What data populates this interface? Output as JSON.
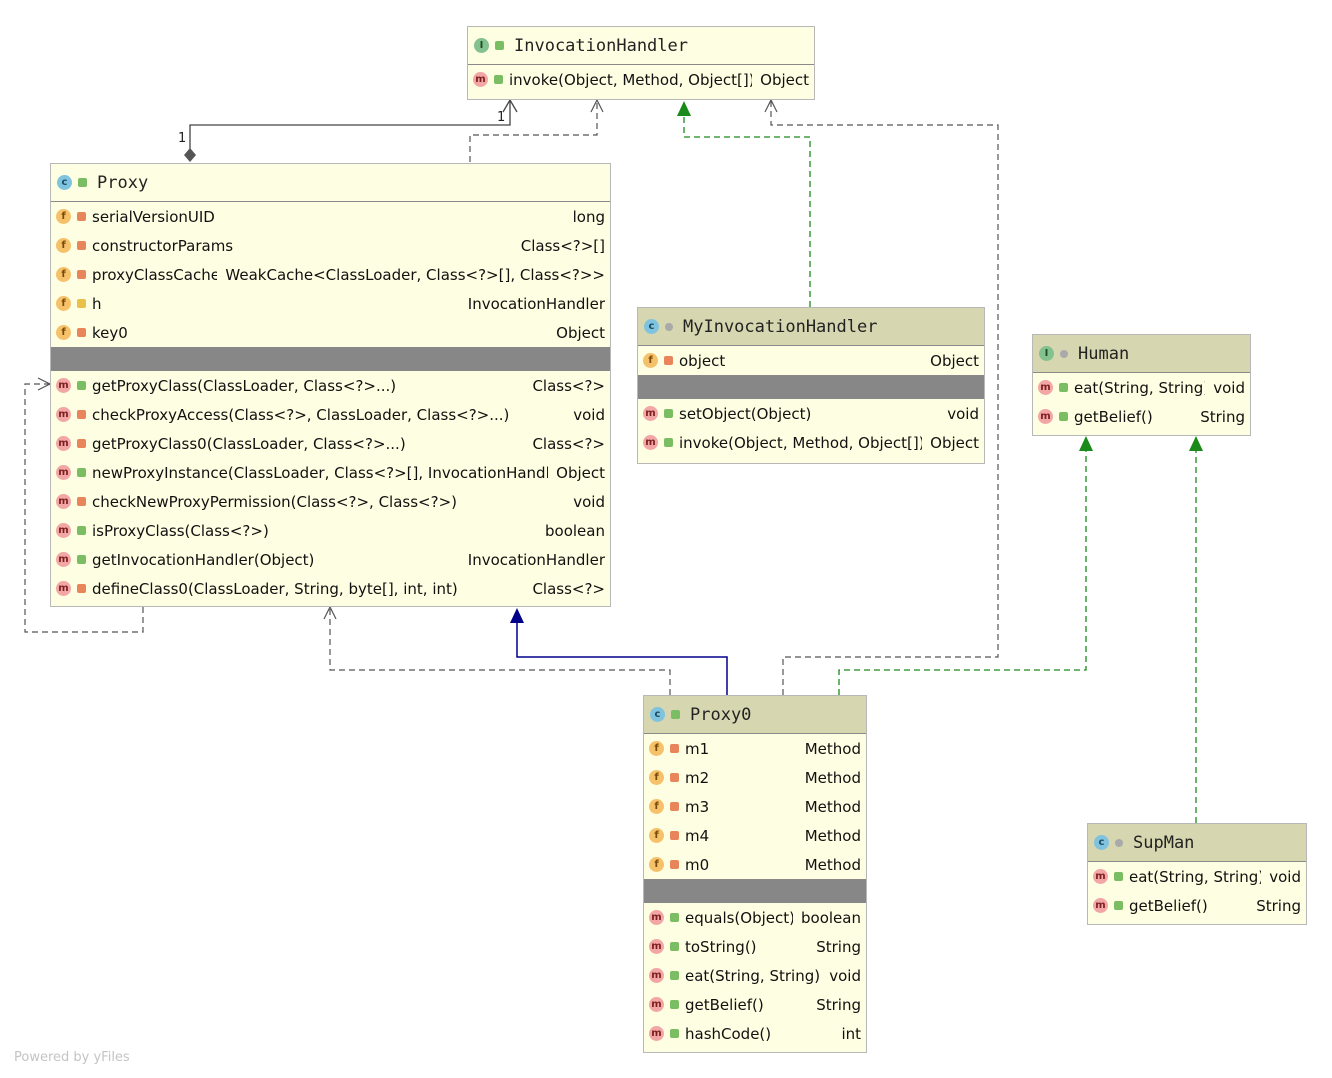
{
  "nodes": {
    "invocation_handler": {
      "kind": "I",
      "visibility": "public",
      "name": "InvocationHandler",
      "fields": [],
      "methods": [
        {
          "icon": "m",
          "vis": "public",
          "name": "invoke(Object, Method, Object[])",
          "type": "Object"
        }
      ]
    },
    "proxy": {
      "kind": "c",
      "visibility": "public",
      "name": "Proxy",
      "fields": [
        {
          "icon": "f",
          "vis": "private",
          "name": "serialVersionUID",
          "type": "long"
        },
        {
          "icon": "f",
          "vis": "private",
          "name": "constructorParams",
          "type": "Class<?>[]"
        },
        {
          "icon": "f",
          "vis": "private",
          "name": "proxyClassCache",
          "type": "WeakCache<ClassLoader, Class<?>[], Class<?>>"
        },
        {
          "icon": "f",
          "vis": "protected",
          "name": "h",
          "type": "InvocationHandler"
        },
        {
          "icon": "f",
          "vis": "private",
          "name": "key0",
          "type": "Object"
        }
      ],
      "methods": [
        {
          "icon": "m",
          "vis": "public",
          "name": "getProxyClass(ClassLoader, Class<?>...)",
          "type": "Class<?>"
        },
        {
          "icon": "m",
          "vis": "private",
          "name": "checkProxyAccess(Class<?>, ClassLoader, Class<?>...)",
          "type": "void"
        },
        {
          "icon": "m",
          "vis": "private",
          "name": "getProxyClass0(ClassLoader, Class<?>...)",
          "type": "Class<?>"
        },
        {
          "icon": "m",
          "vis": "public",
          "name": "newProxyInstance(ClassLoader, Class<?>[], InvocationHandler)",
          "type": "Object"
        },
        {
          "icon": "m",
          "vis": "private",
          "name": "checkNewProxyPermission(Class<?>, Class<?>)",
          "type": "void"
        },
        {
          "icon": "m",
          "vis": "public",
          "name": "isProxyClass(Class<?>)",
          "type": "boolean"
        },
        {
          "icon": "m",
          "vis": "public",
          "name": "getInvocationHandler(Object)",
          "type": "InvocationHandler"
        },
        {
          "icon": "m",
          "vis": "private",
          "name": "defineClass0(ClassLoader, String, byte[], int, int)",
          "type": "Class<?>"
        }
      ]
    },
    "my_invocation_handler": {
      "kind": "c",
      "visibility": "package",
      "name": "MyInvocationHandler",
      "fields": [
        {
          "icon": "f",
          "vis": "private",
          "name": "object",
          "type": "Object"
        }
      ],
      "methods": [
        {
          "icon": "m",
          "vis": "public",
          "name": "setObject(Object)",
          "type": "void"
        },
        {
          "icon": "m",
          "vis": "public",
          "name": "invoke(Object, Method, Object[])",
          "type": "Object"
        }
      ]
    },
    "human": {
      "kind": "I",
      "visibility": "package",
      "name": "Human",
      "fields": [],
      "methods": [
        {
          "icon": "m",
          "vis": "public",
          "name": "eat(String, String)",
          "type": "void"
        },
        {
          "icon": "m",
          "vis": "public",
          "name": "getBelief()",
          "type": "String"
        }
      ]
    },
    "proxy0": {
      "kind": "c",
      "visibility": "public",
      "name": "Proxy0",
      "fields": [
        {
          "icon": "f",
          "vis": "private",
          "name": "m1",
          "type": "Method"
        },
        {
          "icon": "f",
          "vis": "private",
          "name": "m2",
          "type": "Method"
        },
        {
          "icon": "f",
          "vis": "private",
          "name": "m3",
          "type": "Method"
        },
        {
          "icon": "f",
          "vis": "private",
          "name": "m4",
          "type": "Method"
        },
        {
          "icon": "f",
          "vis": "private",
          "name": "m0",
          "type": "Method"
        }
      ],
      "methods": [
        {
          "icon": "m",
          "vis": "public",
          "name": "equals(Object)",
          "type": "boolean"
        },
        {
          "icon": "m",
          "vis": "public",
          "name": "toString()",
          "type": "String"
        },
        {
          "icon": "m",
          "vis": "public",
          "name": "eat(String, String)",
          "type": "void"
        },
        {
          "icon": "m",
          "vis": "public",
          "name": "getBelief()",
          "type": "String"
        },
        {
          "icon": "m",
          "vis": "public",
          "name": "hashCode()",
          "type": "int"
        }
      ]
    },
    "supman": {
      "kind": "c",
      "visibility": "package",
      "name": "SupMan",
      "fields": [],
      "methods": [
        {
          "icon": "m",
          "vis": "public",
          "name": "eat(String, String)",
          "type": "void"
        },
        {
          "icon": "m",
          "vis": "public",
          "name": "getBelief()",
          "type": "String"
        }
      ]
    }
  },
  "multiplicity": {
    "source": "1",
    "target": "1"
  },
  "footer": "Powered by yFiles",
  "colors": {
    "node_fill": "#fefee2",
    "header_gray": "#d6d6b0",
    "divider": "#878787",
    "realization_green": "#1a8a1a",
    "extends_blue": "#00008b",
    "dependency_gray": "#555555"
  }
}
